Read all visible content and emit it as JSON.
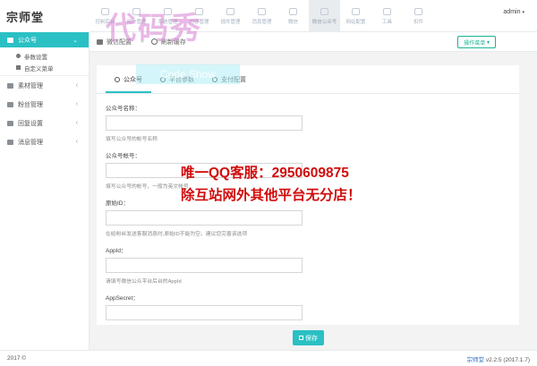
{
  "app": {
    "brand": "宗师堂",
    "user": "admin"
  },
  "topnav": [
    {
      "label": "控制后台"
    },
    {
      "label": "用户管理"
    },
    {
      "label": "系统管理"
    },
    {
      "label": "内容管理"
    },
    {
      "label": "插件管理"
    },
    {
      "label": "消息管理"
    },
    {
      "label": "微信"
    },
    {
      "label": "微信公众号",
      "active": true
    },
    {
      "label": "网站配置"
    },
    {
      "label": "工具"
    },
    {
      "label": "扣件"
    }
  ],
  "sidebar": {
    "active_label": "公众号",
    "sub_items": [
      "参数设置",
      "自定义菜单"
    ],
    "items": [
      "素材管理",
      "粉丝管理",
      "回复设置",
      "消息管理"
    ]
  },
  "breadcrumb": {
    "current": "微信配置",
    "refresh": "刷新缓存",
    "ops_button": "操作菜单"
  },
  "tabs": [
    "公众号",
    "平台参数",
    "支付配置"
  ],
  "form": {
    "fields": [
      {
        "label": "公众号名称：",
        "help": "填写公众号的帐号名称"
      },
      {
        "label": "公众号帐号：",
        "help": "填写公众号的帐号，一般为英文帐号"
      },
      {
        "label": "原始ID：",
        "help": "在给粉丝发送客服消息时,原始ID不能为空。建议您完善该选项"
      },
      {
        "label": "AppId：",
        "help": "请填写微信公众平台后台的AppId"
      },
      {
        "label": "AppSecret：",
        "help": ""
      }
    ],
    "save_label": "保存"
  },
  "watermarks": {
    "big": "代码秀",
    "code_show": "Code Show",
    "line1": "唯一QQ客服：2950609875",
    "line2": "除互站网外其他平台无分店！"
  },
  "footer": {
    "copyright": "2017 ©",
    "brand": "宗师堂",
    "version": "v2.2.5 (2017.1.7)"
  }
}
